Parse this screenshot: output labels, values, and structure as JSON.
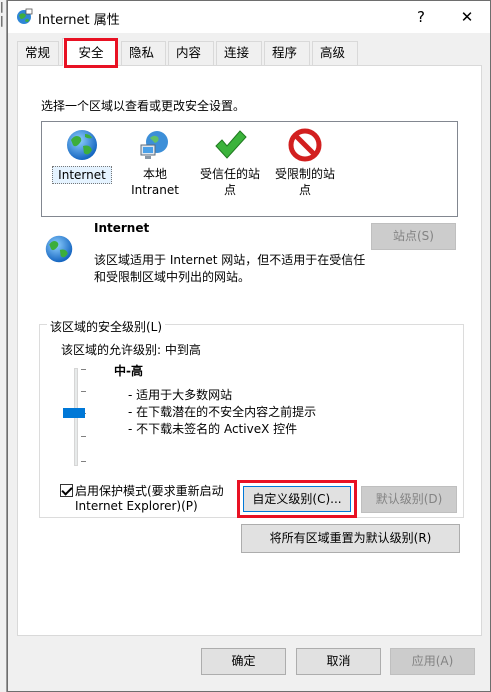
{
  "window": {
    "title": "Internet 属性",
    "minimize_label": "?",
    "close_label": "✕"
  },
  "tabs": [
    {
      "label": "常规"
    },
    {
      "label": "安全"
    },
    {
      "label": "隐私"
    },
    {
      "label": "内容"
    },
    {
      "label": "连接"
    },
    {
      "label": "程序"
    },
    {
      "label": "高级"
    }
  ],
  "security": {
    "zone_prompt": "选择一个区域以查看或更改安全设置。",
    "zones": [
      {
        "line1": "Internet",
        "line2": "",
        "icon": "globe-icon"
      },
      {
        "line1": "本地",
        "line2": "Intranet",
        "icon": "intranet-icon"
      },
      {
        "line1": "受信任的站",
        "line2": "点",
        "icon": "checkmark-icon"
      },
      {
        "line1": "受限制的站",
        "line2": "点",
        "icon": "prohibited-icon"
      }
    ],
    "selected_zone": {
      "name": "Internet",
      "desc_line1": "该区域适用于 Internet 网站，但不适用于在受信任",
      "desc_line2": "和受限制区域中列出的网站。"
    },
    "sites_button": "站点(S)",
    "level_group_title": "该区域的安全级别(L)",
    "allowed_levels": "该区域的允许级别: 中到高",
    "level_name": "中-高",
    "level_points": [
      "- 适用于大多数网站",
      "- 在下载潜在的不安全内容之前提示",
      "- 不下载未签名的 ActiveX 控件"
    ],
    "protected_mode_line1": "启用保护模式(要求重新启动",
    "protected_mode_line2": "Internet Explorer)(P)",
    "protected_mode_checked": true,
    "custom_level_button": "自定义级别(C)...",
    "default_level_button": "默认级别(D)",
    "reset_all_button": "将所有区域重置为默认级别(R)"
  },
  "footer": {
    "ok": "确定",
    "cancel": "取消",
    "apply": "应用(A)"
  },
  "colors": {
    "highlight_red": "#e81123",
    "accent_blue": "#0078d7"
  }
}
